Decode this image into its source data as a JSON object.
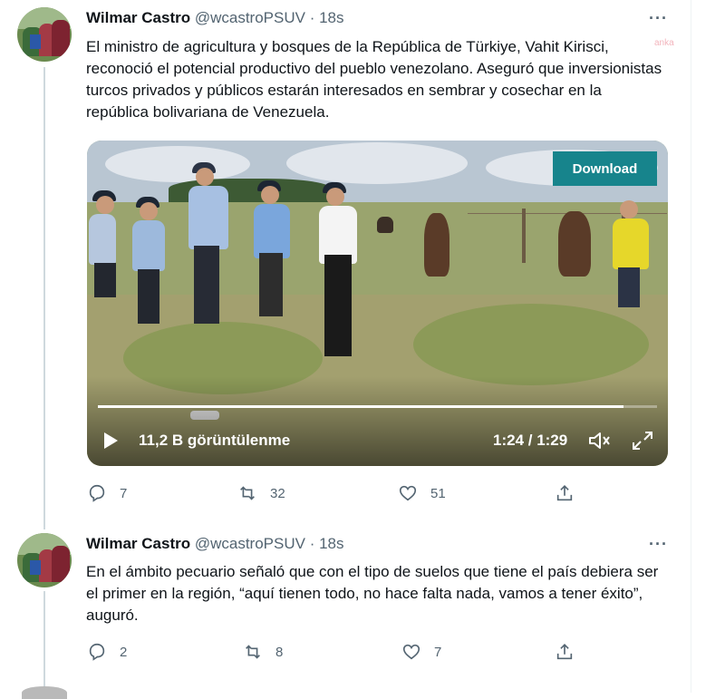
{
  "tweets": [
    {
      "author": "Wilmar Castro",
      "handle": "@wcastroPSUV · 18s",
      "text": "El ministro de agricultura y bosques de la República de Türkiye, Vahit Kirisci, reconoció el potencial productivo del pueblo venezolano. Aseguró que inversionistas turcos privados y públicos estarán interesados en sembrar y cosechar en la república bolivariana de Venezuela.",
      "more": "···",
      "video": {
        "download_label": "Download",
        "views": "11,2 B görüntülenme",
        "time": "1:24 / 1:29",
        "progress_fraction": 0.94
      },
      "actions": {
        "replies": "7",
        "retweets": "32",
        "likes": "51"
      }
    },
    {
      "author": "Wilmar Castro",
      "handle": "@wcastroPSUV · 18s",
      "text": "En el ámbito pecuario señaló que con el tipo de suelos que tiene el país debiera ser el primer en la región, “aquí tienen todo, no hace falta nada, vamos a tener éxito”, auguró.",
      "more": "···",
      "actions": {
        "replies": "2",
        "retweets": "8",
        "likes": "7"
      }
    }
  ],
  "watermark": "anka",
  "icons": {
    "reply": "reply-icon",
    "retweet": "retweet-icon",
    "like": "heart-icon",
    "share": "share-icon",
    "play": "play-icon",
    "volume": "volume-icon",
    "expand": "fullscreen-icon"
  },
  "colors": {
    "download_bg": "#17848c",
    "text_secondary": "#536471",
    "thread_line": "#cfd9de"
  }
}
